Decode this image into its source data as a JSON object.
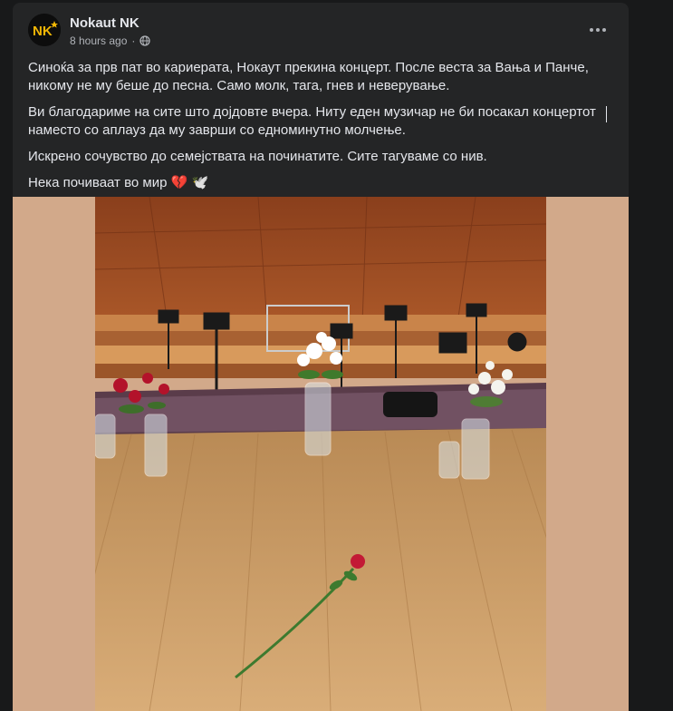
{
  "post": {
    "author": "Nokaut NK",
    "avatar_text": "NK",
    "timestamp": "8 hours ago",
    "separator": "·",
    "audience_icon": "globe-icon",
    "more_icon": "more-options-icon",
    "paragraphs": [
      "Синоќа за прв пат во кариерата, Нокаут прекина концерт. После веста за Вања и Панче, никому не му беше до песна. Само молк, тага, гнев и неверување.",
      "Ви благодариме на сите што дојдовте вчера. Ниту еден музичар не би посакал концертот наместо со аплауз да му заврши со едноминутно молчење.",
      "Искрено сочувство до семејствата на починатите. Сите тагуваме со нив.",
      "Нека почиваат во мир 💔 🕊️"
    ],
    "photo_alt_icon": "concert-stage-photo"
  },
  "colors": {
    "background": "#18191a",
    "card": "#242526",
    "text_primary": "#e4e6eb",
    "text_secondary": "#b0b3b8",
    "photo_matte": "#d2a98a",
    "avatar_gold": "#f2b705"
  }
}
